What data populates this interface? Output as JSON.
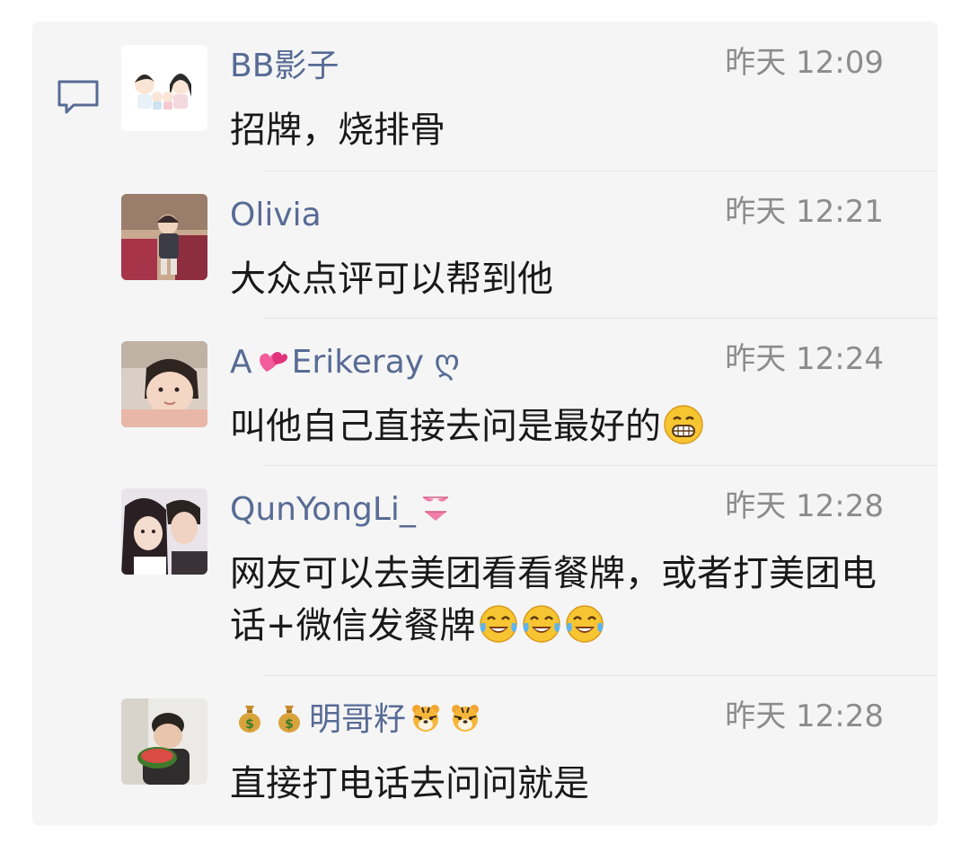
{
  "comments": [
    {
      "name": "BB影子",
      "time": "昨天 12:09",
      "text": "招牌，烧排骨",
      "avatar": "couple-cartoon-avatar"
    },
    {
      "name": "Olivia",
      "time": "昨天 12:21",
      "text": "大众点评可以帮到他",
      "avatar": "child-in-store-photo-avatar"
    },
    {
      "name_prefix": "A",
      "name_suffix": "Erikeray ღ",
      "name_emoji": "heart-emoji",
      "time": "昨天 12:24",
      "text": "叫他自己直接去问是最好的",
      "text_emoji": "grin-emoji",
      "avatar": "baby-photo-avatar"
    },
    {
      "name": "QunYongLi_",
      "name_emoji": "bikini-emoji",
      "time": "昨天 12:28",
      "text": "网友可以去美团看看餐牌，或者打美团电话+微信发餐牌",
      "text_emojis": [
        "tears-of-joy-emoji",
        "tears-of-joy-emoji",
        "tears-of-joy-emoji"
      ],
      "avatar": "couple-photo-avatar"
    },
    {
      "name": "明哥籽",
      "name_prefix_emojis": [
        "money-bag-emoji",
        "money-bag-emoji"
      ],
      "name_suffix_emojis": [
        "tiger-emoji",
        "tiger-emoji"
      ],
      "time": "昨天 12:28",
      "text": "直接打电话去问问就是",
      "avatar": "man-eating-watermelon-avatar"
    }
  ],
  "colors": {
    "name": "#576b95",
    "time": "#8c8c8c",
    "text": "#191919",
    "panel_bg": "#f5f5f5"
  },
  "icons": {
    "comment": "comment-bubble-icon"
  }
}
